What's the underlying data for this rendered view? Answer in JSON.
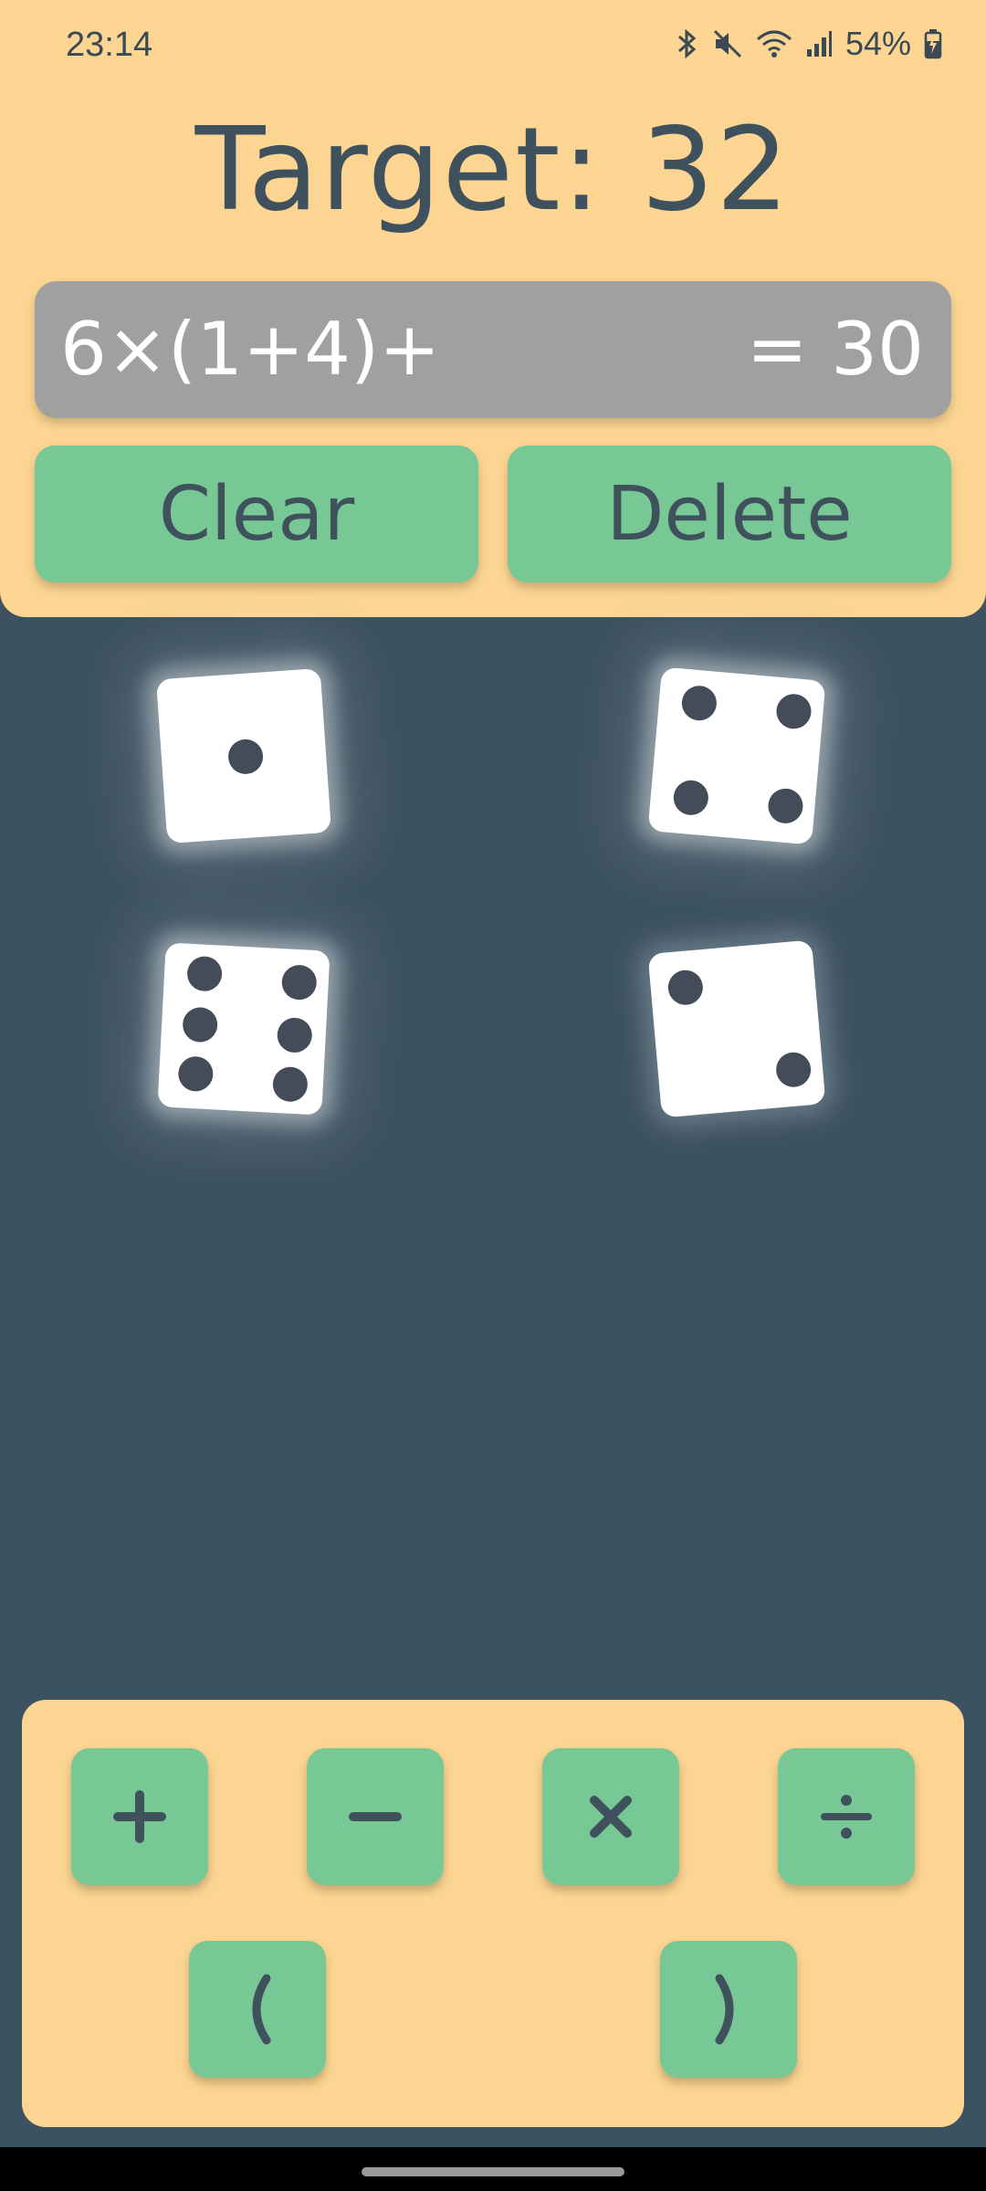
{
  "status": {
    "time": "23:14",
    "battery": "54%",
    "icons": [
      "bluetooth-icon",
      "mute-icon",
      "wifi-icon",
      "signal-icon",
      "battery-charging-icon"
    ]
  },
  "game": {
    "target_text": "Target: 32",
    "expression": "6×(1+4)+",
    "result": "= 30",
    "clear_label": "Clear",
    "delete_label": "Delete"
  },
  "dice": [
    {
      "value": 1
    },
    {
      "value": 4
    },
    {
      "value": 6
    },
    {
      "value": 2
    }
  ],
  "operators": [
    {
      "symbol": "+",
      "icon": "plus-icon"
    },
    {
      "symbol": "−",
      "icon": "minus-icon"
    },
    {
      "symbol": "×",
      "icon": "times-icon"
    },
    {
      "symbol": "÷",
      "icon": "divide-icon"
    },
    {
      "symbol": "(",
      "icon": "open-paren-icon"
    },
    {
      "symbol": ")",
      "icon": "close-paren-icon"
    }
  ],
  "colors": {
    "panel": "#fcd592",
    "background": "#3d5260",
    "button": "#78c896",
    "text": "#3e515c",
    "expression_bg": "#a0a0a0"
  }
}
